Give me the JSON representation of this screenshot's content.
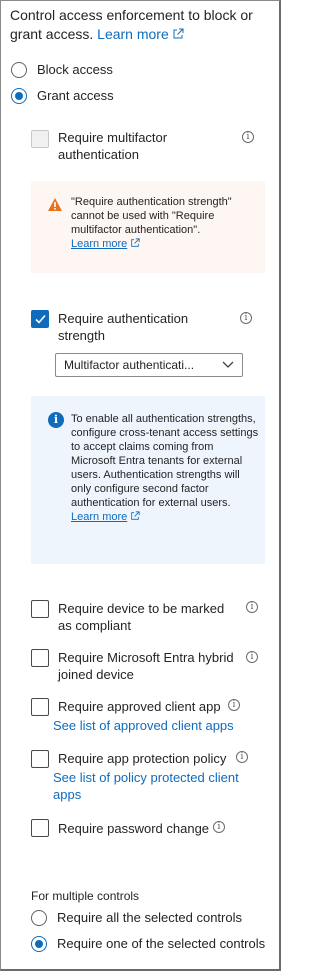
{
  "intro": {
    "text": "Control access enforcement to block or grant access.",
    "learn_more": "Learn more"
  },
  "access": {
    "block_label": "Block access",
    "grant_label": "Grant access",
    "selected": "grant"
  },
  "grant": {
    "mfa": {
      "label": "Require multifactor authentication",
      "checked": false,
      "disabled": true
    },
    "warning": {
      "text": "\"Require authentication strength\" cannot be used with \"Require multifactor authentication\".",
      "learn_more": "Learn more"
    },
    "auth_strength": {
      "label": "Require authentication strength",
      "checked": true,
      "dropdown_value": "Multifactor authenticati..."
    },
    "info": {
      "text": "To enable all authentication strengths, configure cross-tenant access settings to accept claims coming from Microsoft Entra tenants for external users. Authentication strengths will only configure second factor authentication for external users.",
      "learn_more": "Learn more"
    },
    "compliant": {
      "label": "Require device to be marked as compliant",
      "checked": false
    },
    "hybrid": {
      "label": "Require Microsoft Entra hybrid joined device",
      "checked": false
    },
    "approved_app": {
      "label": "Require approved client app",
      "link": "See list of approved client apps",
      "checked": false
    },
    "app_protection": {
      "label": "Require app protection policy",
      "link": "See list of policy protected client apps",
      "checked": false
    },
    "password_change": {
      "label": "Require password change",
      "checked": false
    }
  },
  "multiple": {
    "title": "For multiple controls",
    "all_label": "Require all the selected controls",
    "one_label": "Require one of the selected controls",
    "selected": "one"
  },
  "colors": {
    "accent": "#0f6cbd",
    "warning": "#e8731c",
    "warning_bg": "#fdf6f3",
    "info_bg": "#eff5fd"
  },
  "icons": [
    "external-link-icon",
    "info-icon",
    "warning-icon",
    "checkmark-icon",
    "chevron-down-icon"
  ]
}
